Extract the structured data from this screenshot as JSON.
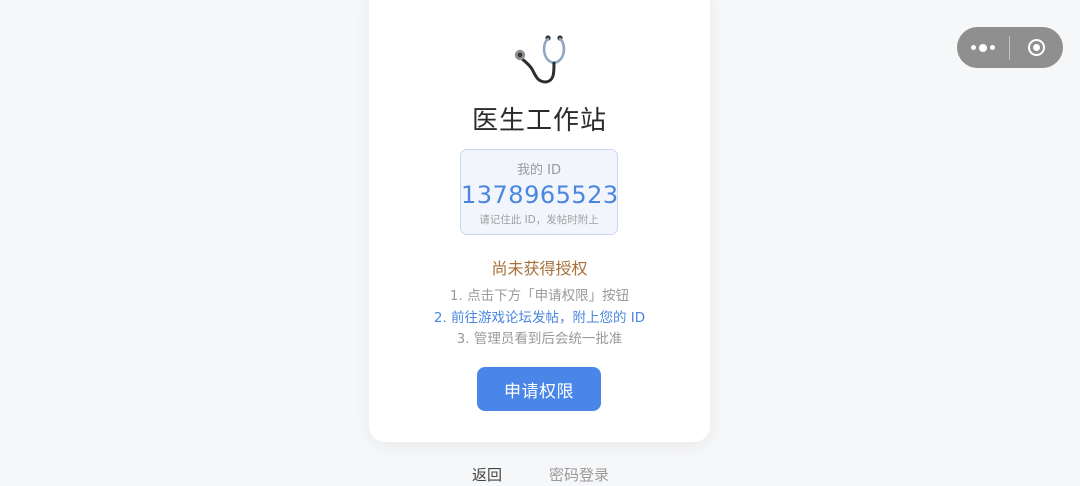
{
  "capsule": {
    "more_icon": "more-dots-icon",
    "close_icon": "target-circle-icon"
  },
  "card": {
    "icon": "stethoscope-icon",
    "title": "医生工作站",
    "id_box": {
      "label": "我的 ID",
      "value": "1378965523",
      "hint": "请记住此 ID，发帖时附上"
    },
    "status": "尚未获得授权",
    "steps": [
      "1. 点击下方「申请权限」按钮",
      "2. 前往游戏论坛发帖，附上您的 ID",
      "3. 管理员看到后会统一批准"
    ],
    "apply_button": "申请权限"
  },
  "footer": {
    "back": "返回",
    "password_login": "密码登录"
  },
  "colors": {
    "primary": "#4a86e8",
    "status": "#a8703a",
    "id_text": "#4a86e0"
  }
}
